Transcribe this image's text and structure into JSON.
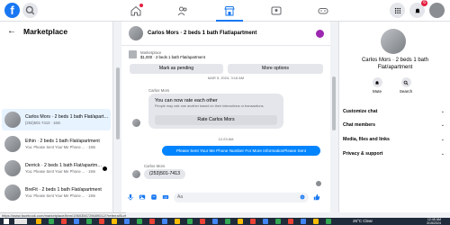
{
  "topbar": {
    "logo": "f",
    "notif_count": "6",
    "nav": [
      {
        "icon": "home-icon",
        "active": false
      },
      {
        "icon": "friends-icon",
        "active": false
      },
      {
        "icon": "marketplace-icon",
        "active": true
      },
      {
        "icon": "groups-icon",
        "active": false
      },
      {
        "icon": "gaming-icon",
        "active": false
      }
    ]
  },
  "left": {
    "title": "Marketplace",
    "listings": [
      {
        "title": "Carlos Mors · 2 beds 1 bath Flat/apartment",
        "sub": "(253)501-7413 · 16m",
        "active": true
      },
      {
        "title": "Ethin · 2 beds 1 bath Flat/apartment",
        "sub": "You: Please Sent Your Me Phone ... · 19m",
        "active": false
      },
      {
        "title": "Derrick · 2 beds 1 bath Flat/apartment",
        "sub": "You: Please Sent Your Me Phone ... · 19m",
        "active": false
      },
      {
        "title": "BreFit · 2 beds 1 bath Flat/apartment",
        "sub": "You: Please Sent Your Me Phone ... · 19m",
        "active": false
      }
    ]
  },
  "chat": {
    "title": "Carlos Mors · 2 beds 1 bath Flat/apartment",
    "listing_label": "Marketplace",
    "listing_price": "$1,000 · 2 beds 1 bath Flat/apartment",
    "btn_pending": "Mark as pending",
    "btn_more": "More options",
    "timestamp_top": "MAR 5, 2024, 3:16 AM",
    "sender": "Carlos Mors",
    "rate_title": "You can now rate each other",
    "rate_sub": "People may rate one another based on their interactions or transactions.",
    "rate_btn": "Rate Carlos Mors",
    "timestamp_mid": "12:23 AM",
    "outgoing": "Please Sent Your Me Phone Number For More InformationPlease Sent",
    "incoming": "(253)501-7413",
    "composer_placeholder": "Aa"
  },
  "right": {
    "title": "Carlos Mors · 2 beds 1 bath Flat/apartment",
    "actions": [
      {
        "label": "Mute",
        "icon": "bell-icon"
      },
      {
        "label": "Search",
        "icon": "search-icon"
      }
    ],
    "sections": [
      "Customize chat",
      "Chat members",
      "Media, files and links",
      "Privacy & support"
    ]
  },
  "status_url": "https://www.facebook.com/marketplace/item/1960356729689012/?referralSurfac...",
  "taskbar": {
    "weather": "26°C  Clear",
    "time": "12:45 AM",
    "date": "3/15/2024"
  }
}
